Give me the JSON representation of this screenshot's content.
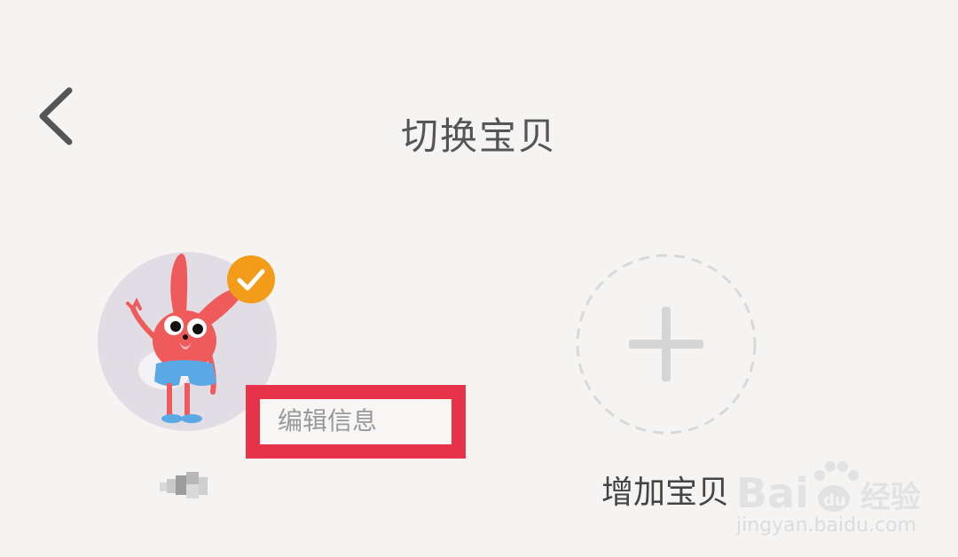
{
  "header": {
    "title": "切换宝贝"
  },
  "babies": [
    {
      "edit_label": "编辑信息",
      "selected": true
    }
  ],
  "add_baby": {
    "label": "增加宝贝"
  },
  "watermark": {
    "brand": "Baidu经验",
    "url": "jingyan.baidu.com"
  },
  "colors": {
    "accent": "#f39c1a",
    "highlight_box": "#e6334a",
    "avatar_bg": "#e1dde4",
    "character": "#ef5b5b"
  }
}
